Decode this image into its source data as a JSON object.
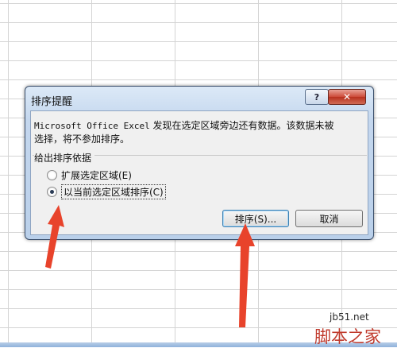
{
  "dialog": {
    "title": "排序提醒",
    "help_label": "?",
    "close_label": "✕",
    "message_app": "Microsoft Office Excel",
    "message_line1": " 发现在选定区域旁边还有数据。该数据未被",
    "message_line2": "选择，将不参加排序。",
    "group_label": "给出排序依据",
    "options": [
      {
        "label": "扩展选定区域(E)",
        "selected": false
      },
      {
        "label": "以当前选定区域排序(C)",
        "selected": true
      }
    ],
    "sort_button": "排序(S)...",
    "cancel_button": "取消"
  },
  "watermark": {
    "site": "jb51.net",
    "brand": "脚本之家"
  },
  "colors": {
    "arrow": "#e8432b",
    "dialog_frame": "#bad0ea",
    "close_button": "#cc4a38"
  }
}
